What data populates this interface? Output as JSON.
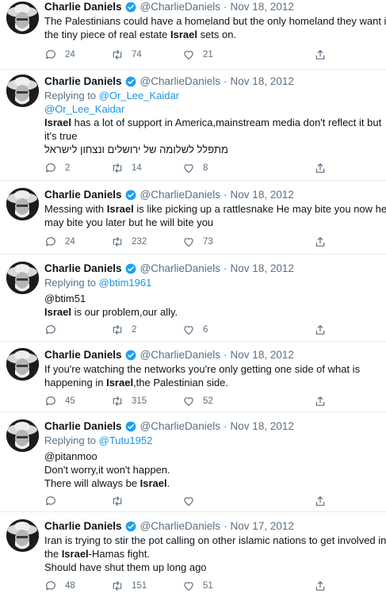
{
  "colors": {
    "link": "#1b95e0",
    "verified": "#1da1f2",
    "muted": "#5b7083",
    "divider": "#e6ecf0"
  },
  "icons": {
    "reply": "speech-bubble-icon",
    "retweet": "retweet-icon",
    "like": "heart-icon",
    "share": "share-icon",
    "verified": "verified-badge-icon"
  },
  "tweets": [
    {
      "name": "Charlie Daniels",
      "handle": "@CharlieDaniels",
      "dot": "·",
      "date": "Nov 18, 2012",
      "lines": [
        {
          "pre": "The Palestinians could have a homeland but the only homeland they want is",
          "bold": "",
          "post": ""
        },
        {
          "pre": "the tiny  piece of real estate ",
          "bold": "Israel",
          "post": " sets on."
        }
      ],
      "replies": "24",
      "retweets": "74",
      "likes": "21"
    },
    {
      "name": "Charlie Daniels",
      "handle": "@CharlieDaniels",
      "dot": "·",
      "date": "Nov 18, 2012",
      "replying_label": "Replying to ",
      "replying_to": "@Or_Lee_Kaidar",
      "mention": "@Or_Lee_Kaidar",
      "lines": [
        {
          "pre": "",
          "bold": "Israel",
          "post": " has a lot of support in America,mainstream media don't reflect it but"
        },
        {
          "pre": "it's true",
          "bold": "",
          "post": ""
        }
      ],
      "rtl_line": "מתפלל לשלומה של ירושלים ונצחון לישראל",
      "replies": "2",
      "retweets": "14",
      "likes": "8"
    },
    {
      "name": "Charlie Daniels",
      "handle": "@CharlieDaniels",
      "dot": "·",
      "date": "Nov 18, 2012",
      "lines": [
        {
          "pre": "Messing with ",
          "bold": "Israel",
          "post": " is like picking up a rattlesnake He  may bite you now he"
        },
        {
          "pre": "may bite you later but he will bite you",
          "bold": "",
          "post": ""
        }
      ],
      "replies": "24",
      "retweets": "232",
      "likes": "73"
    },
    {
      "name": "Charlie Daniels",
      "handle": "@CharlieDaniels",
      "dot": "·",
      "date": "Nov 18, 2012",
      "replying_label": "Replying to ",
      "replying_to": "@btim1961",
      "lines": [
        {
          "pre": "@btim51",
          "bold": "",
          "post": ""
        },
        {
          "pre": "",
          "bold": "Israel",
          "post": " is our problem,our ally."
        }
      ],
      "replies": "",
      "retweets": "2",
      "likes": "6"
    },
    {
      "name": "Charlie Daniels",
      "handle": "@CharlieDaniels",
      "dot": "·",
      "date": "Nov 18, 2012",
      "lines": [
        {
          "pre": "If you're watching the networks you're only getting one side of what is",
          "bold": "",
          "post": ""
        },
        {
          "pre": "happening in ",
          "bold": "Israel",
          "post": ",the Palestinian side."
        }
      ],
      "replies": "45",
      "retweets": "315",
      "likes": "52"
    },
    {
      "name": "Charlie Daniels",
      "handle": "@CharlieDaniels",
      "dot": "·",
      "date": "Nov 18, 2012",
      "replying_label": "Replying to ",
      "replying_to": "@Tutu1952",
      "lines": [
        {
          "pre": "@pitanmoo",
          "bold": "",
          "post": ""
        },
        {
          "pre": "Don't worry,it won't happen.",
          "bold": "",
          "post": ""
        },
        {
          "pre": "There will always be ",
          "bold": "Israel",
          "post": "."
        }
      ],
      "replies": "",
      "retweets": "",
      "likes": ""
    },
    {
      "name": "Charlie Daniels",
      "handle": "@CharlieDaniels",
      "dot": "·",
      "date": "Nov 17, 2012",
      "lines": [
        {
          "pre": "Iran is trying to stir the pot calling on other islamic nations to get involved in",
          "bold": "",
          "post": ""
        },
        {
          "pre": "the ",
          "bold": "Israel",
          "post": "-Hamas fight."
        },
        {
          "pre": "Should have shut them up long ago",
          "bold": "",
          "post": ""
        }
      ],
      "replies": "48",
      "retweets": "151",
      "likes": "51"
    }
  ]
}
